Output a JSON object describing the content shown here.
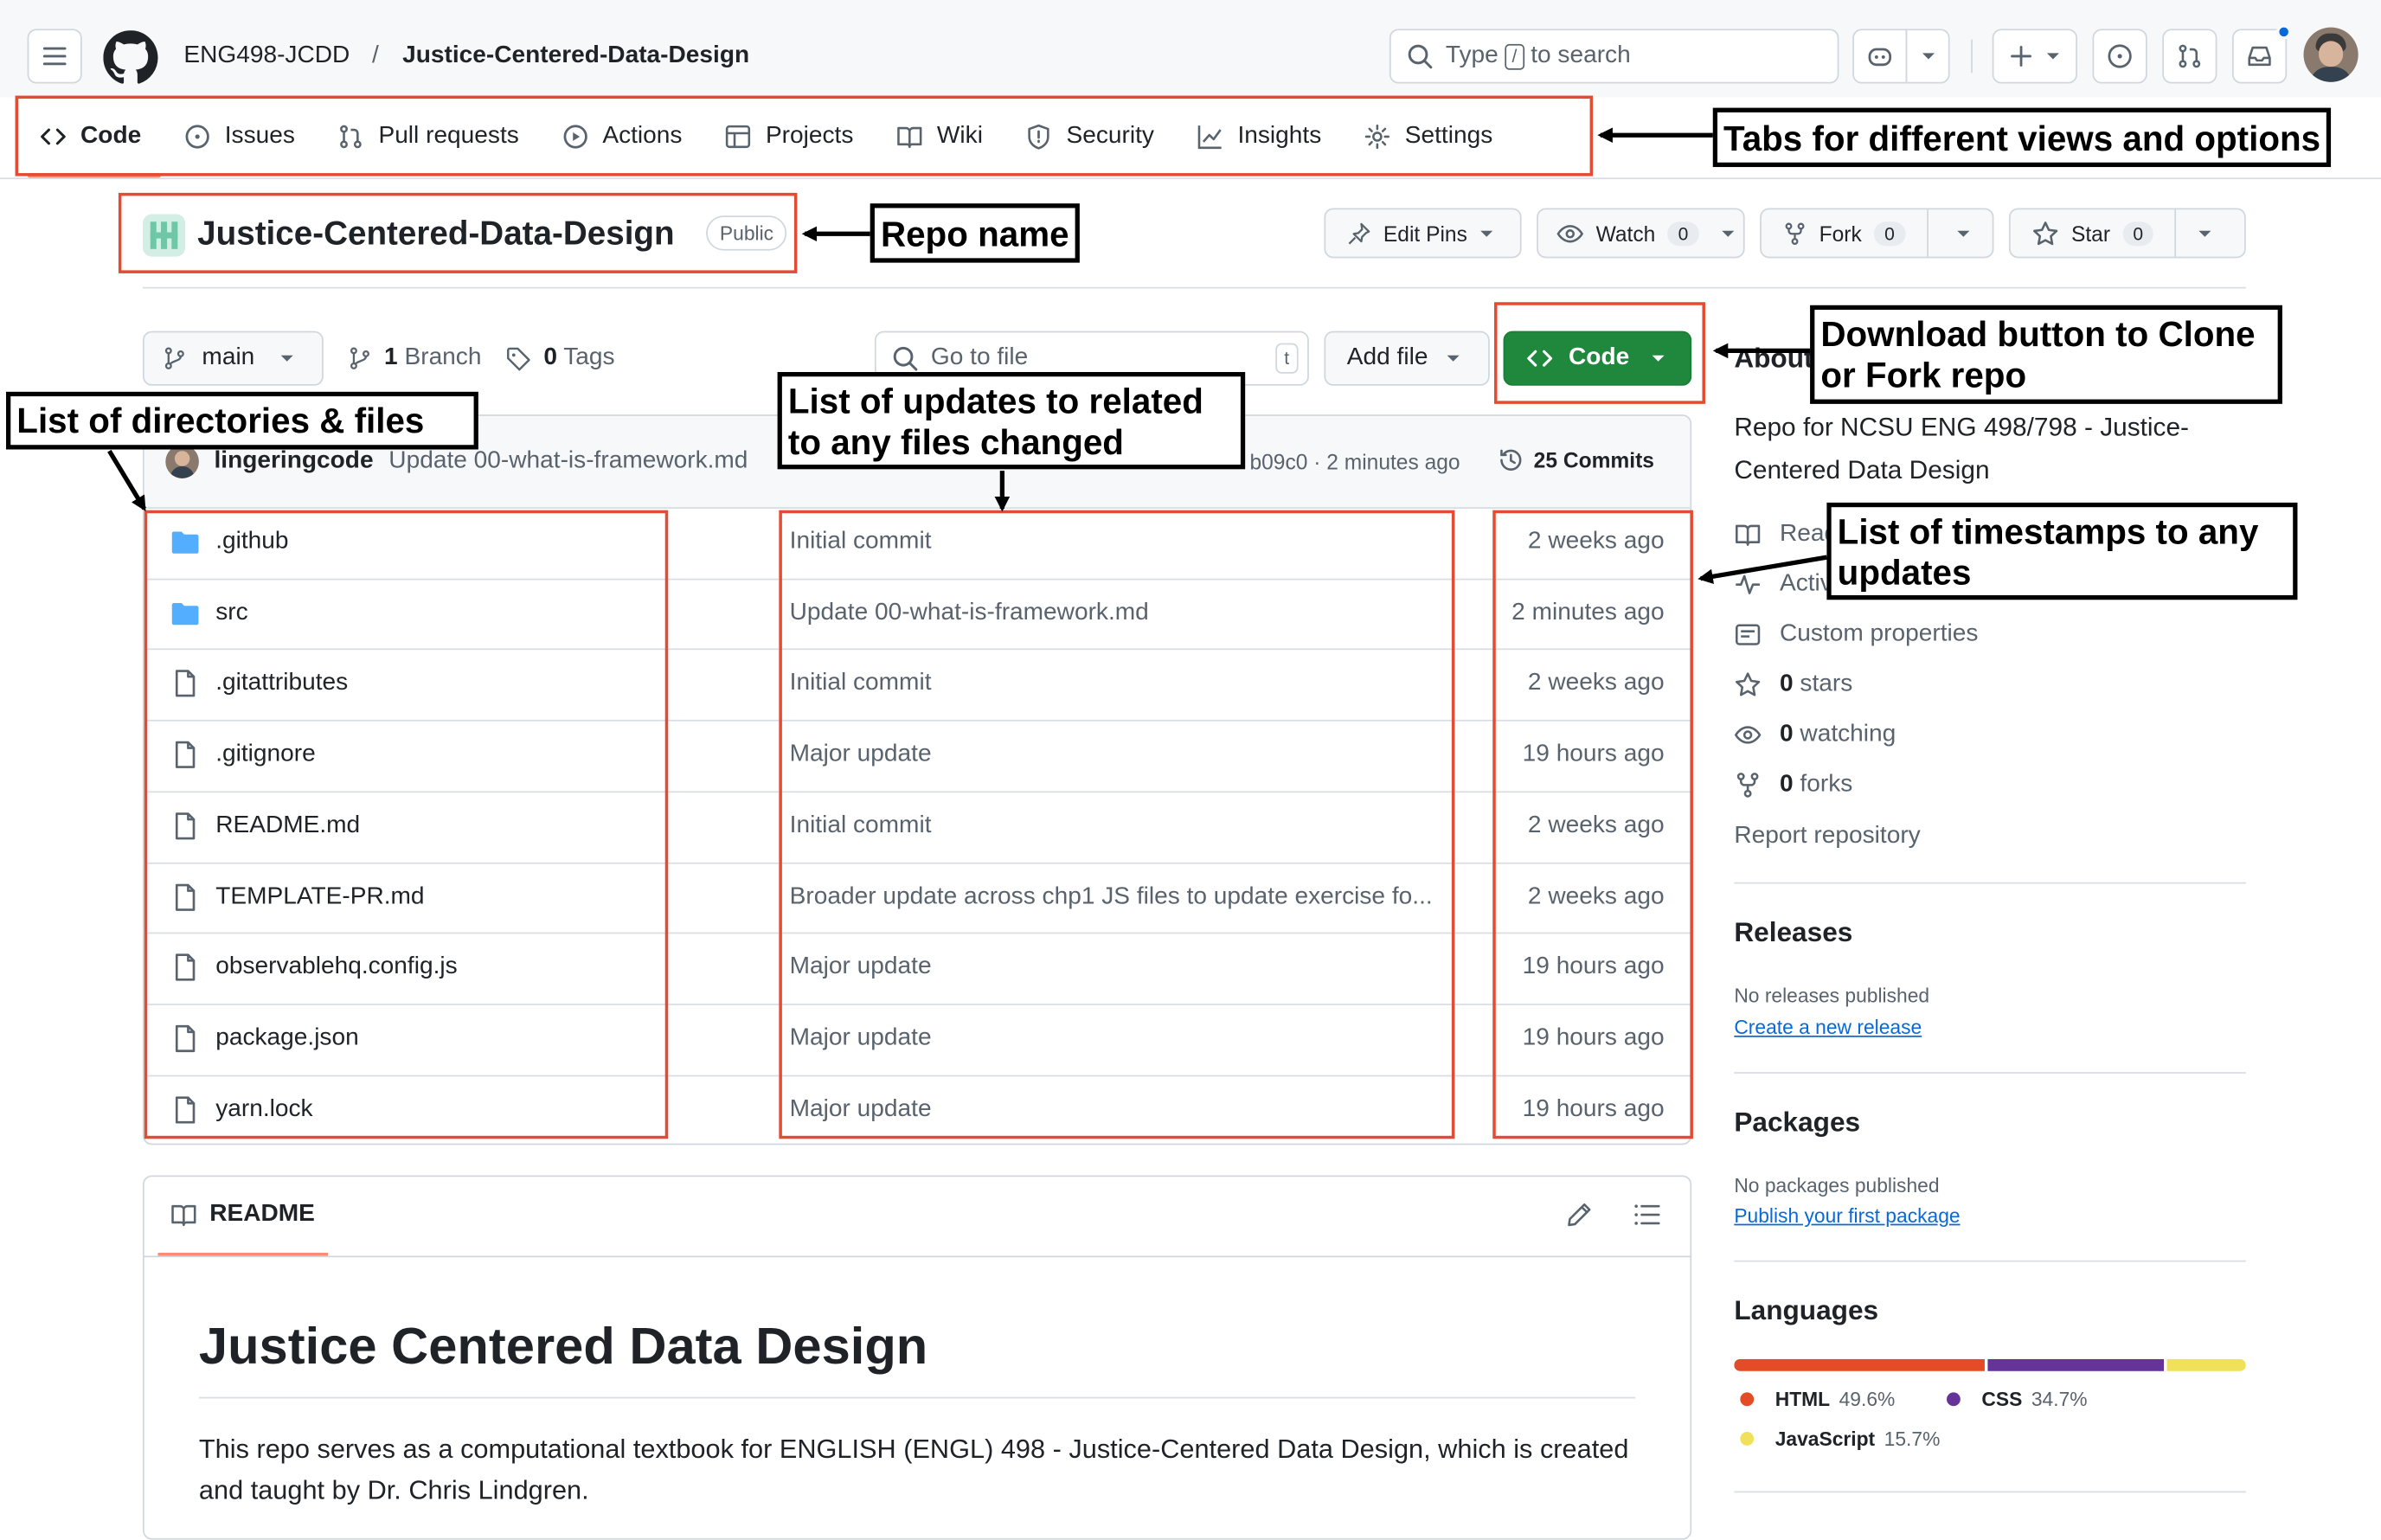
{
  "header": {
    "owner": "ENG498-JCDD",
    "separator": "/",
    "repo": "Justice-Centered-Data-Design",
    "search_prefix": "Type",
    "search_key": "/",
    "search_suffix": "to search"
  },
  "tabs": [
    {
      "label": "Code",
      "icon": "code-icon"
    },
    {
      "label": "Issues",
      "icon": "issue-icon"
    },
    {
      "label": "Pull requests",
      "icon": "pull-request-icon"
    },
    {
      "label": "Actions",
      "icon": "play-icon"
    },
    {
      "label": "Projects",
      "icon": "table-icon"
    },
    {
      "label": "Wiki",
      "icon": "book-icon"
    },
    {
      "label": "Security",
      "icon": "shield-icon"
    },
    {
      "label": "Insights",
      "icon": "graph-icon"
    },
    {
      "label": "Settings",
      "icon": "gear-icon"
    }
  ],
  "repo": {
    "name": "Justice-Centered-Data-Design",
    "visibility": "Public",
    "edit_pins": "Edit Pins",
    "watch": "Watch",
    "watch_count": "0",
    "fork": "Fork",
    "fork_count": "0",
    "star": "Star",
    "star_count": "0"
  },
  "toolbar": {
    "branch": "main",
    "branch_count": "1",
    "branch_label": "Branch",
    "tag_count": "0",
    "tag_label": "Tags",
    "goto_placeholder": "Go to file",
    "goto_key": "t",
    "add_file": "Add file",
    "code_button": "Code"
  },
  "commit": {
    "author": "lingeringcode",
    "message": "Update 00-what-is-framework.md",
    "hash_time": "b09c0 · 2 minutes ago",
    "commits_count": "25",
    "commits_label": "Commits"
  },
  "files": [
    {
      "type": "folder",
      "name": ".github",
      "message": "Initial commit",
      "time": "2 weeks ago"
    },
    {
      "type": "folder",
      "name": "src",
      "message": "Update 00-what-is-framework.md",
      "time": "2 minutes ago"
    },
    {
      "type": "file",
      "name": ".gitattributes",
      "message": "Initial commit",
      "time": "2 weeks ago"
    },
    {
      "type": "file",
      "name": ".gitignore",
      "message": "Major update",
      "time": "19 hours ago"
    },
    {
      "type": "file",
      "name": "README.md",
      "message": "Initial commit",
      "time": "2 weeks ago"
    },
    {
      "type": "file",
      "name": "TEMPLATE-PR.md",
      "message": "Broader update across chp1 JS files to update exercise fo...",
      "time": "2 weeks ago"
    },
    {
      "type": "file",
      "name": "observablehq.config.js",
      "message": "Major update",
      "time": "19 hours ago"
    },
    {
      "type": "file",
      "name": "package.json",
      "message": "Major update",
      "time": "19 hours ago"
    },
    {
      "type": "file",
      "name": "yarn.lock",
      "message": "Major update",
      "time": "19 hours ago"
    }
  ],
  "readme": {
    "tab_label": "README",
    "title": "Justice Centered Data Design",
    "body": "This repo serves as a computational textbook for ENGLISH (ENGL) 498 - Justice-Centered Data Design, which is created and taught by Dr. Chris Lindgren."
  },
  "about": {
    "heading": "About",
    "description": "Repo for NCSU ENG 498/798 - Justice-Centered Data Design",
    "readme": "Readme",
    "activity": "Activity",
    "custom_properties": "Custom properties",
    "stars_count": "0",
    "stars_label": "stars",
    "watching_count": "0",
    "watching_label": "watching",
    "forks_count": "0",
    "forks_label": "forks",
    "report": "Report repository"
  },
  "releases": {
    "heading": "Releases",
    "none": "No releases published",
    "link": "Create a new release"
  },
  "packages": {
    "heading": "Packages",
    "none": "No packages published",
    "link": "Publish your first package"
  },
  "languages": {
    "heading": "Languages",
    "items": [
      {
        "name": "HTML",
        "percent": "49.6%",
        "value": 49.6,
        "color": "#e34c26"
      },
      {
        "name": "CSS",
        "percent": "34.7%",
        "value": 34.7,
        "color": "#663399"
      },
      {
        "name": "JavaScript",
        "percent": "15.7%",
        "value": 15.7,
        "color": "#f1e05a"
      }
    ]
  },
  "annotations": {
    "tabs": "Tabs for different views and options",
    "repo_name": "Repo name",
    "files": "List of directories & files",
    "updates_line1": "List of updates to related",
    "updates_line2": "to any files changed",
    "download_line1": "Download button to Clone",
    "download_line2": "or Fork repo",
    "timestamps_line1": "List of timestamps to any",
    "timestamps_line2": "updates"
  },
  "colors": {
    "accent_red": "#e34b32",
    "code_green": "#1f883d",
    "link_blue": "#0969da"
  }
}
